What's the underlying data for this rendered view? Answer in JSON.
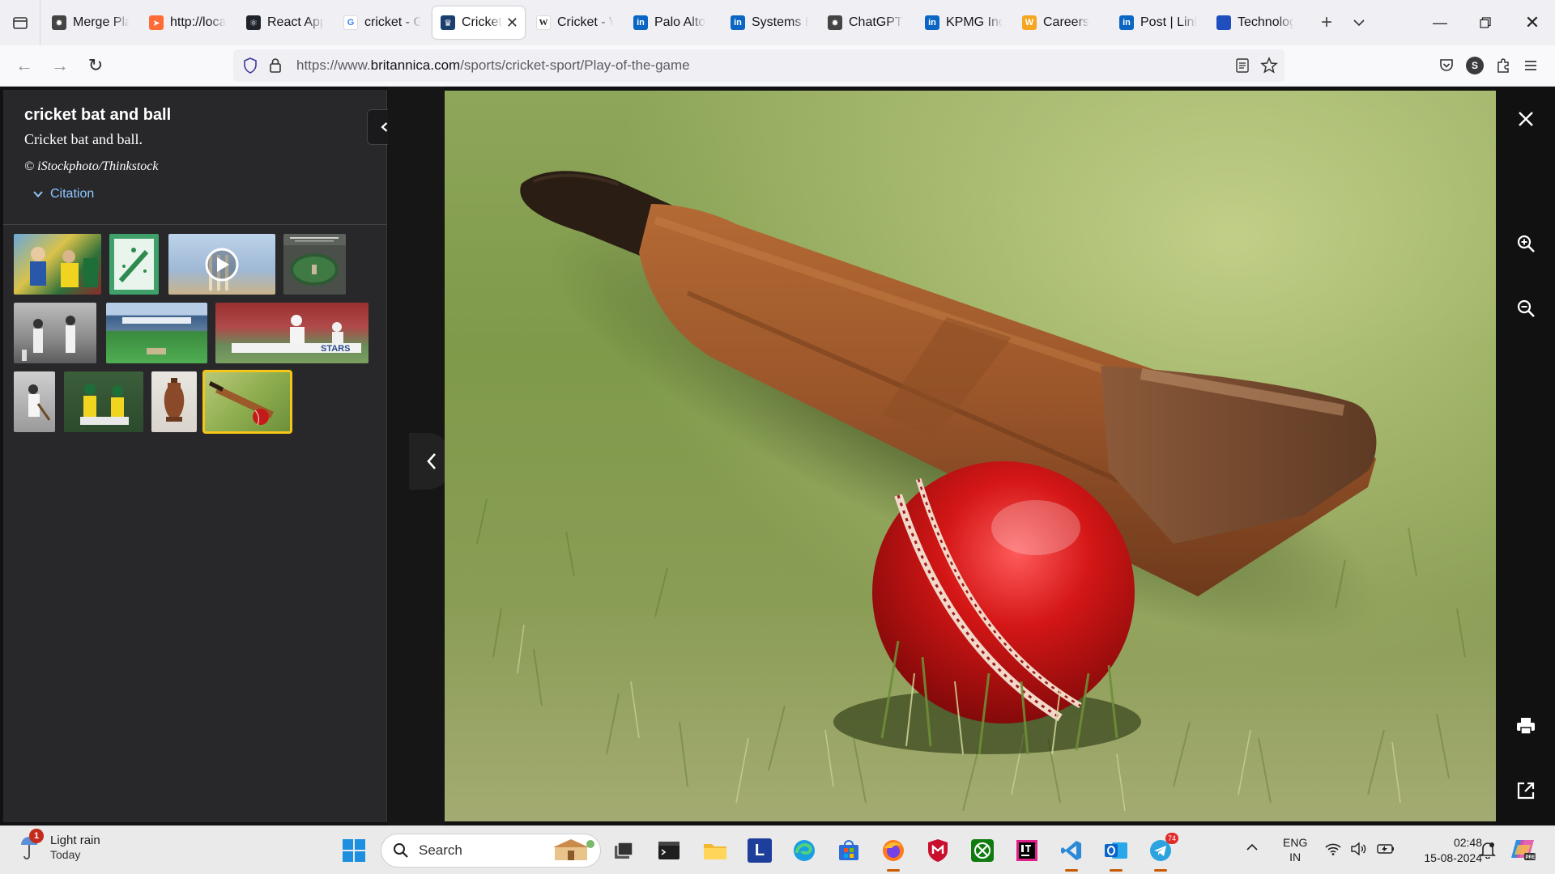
{
  "browser": {
    "tabs": [
      {
        "label": "Merge Pla",
        "icon": "chatgpt-icon",
        "active": false
      },
      {
        "label": "http://loca",
        "icon": "postman-icon",
        "active": false
      },
      {
        "label": "React App",
        "icon": "react-icon",
        "active": false
      },
      {
        "label": "cricket - G",
        "icon": "google-icon",
        "active": false
      },
      {
        "label": "Cricket",
        "icon": "britannica-icon",
        "active": true
      },
      {
        "label": "Cricket - V",
        "icon": "wikipedia-icon",
        "active": false
      },
      {
        "label": "Palo Alto",
        "icon": "linkedin-icon",
        "active": false
      },
      {
        "label": "Systems E",
        "icon": "linkedin-icon",
        "active": false
      },
      {
        "label": "ChatGPT",
        "icon": "chatgpt-icon",
        "active": false
      },
      {
        "label": "KPMG Ind",
        "icon": "linkedin-icon",
        "active": false
      },
      {
        "label": "Careers",
        "icon": "workday-icon",
        "active": false
      },
      {
        "label": "Post | Link",
        "icon": "linkedin-icon",
        "active": false
      },
      {
        "label": "Technolog",
        "icon": "bookmark-blue-icon",
        "active": false
      }
    ],
    "url_prefix": "https://www.",
    "url_domain": "britannica.com",
    "url_path": "/sports/cricket-sport/Play-of-the-game",
    "profile_initial": "S"
  },
  "media": {
    "title": "cricket bat and ball",
    "description": "Cricket bat and ball.",
    "credit": "© iStockphoto/Thinkstock",
    "citation_label": "Citation"
  },
  "thumbnails": [
    {
      "name": "cricket-match-players",
      "kind": "photo"
    },
    {
      "name": "cricket-field-diagram",
      "kind": "diagram"
    },
    {
      "name": "cricket-stumps-video",
      "kind": "video"
    },
    {
      "name": "lords-cricket-ground-map",
      "kind": "photo"
    },
    {
      "name": "historic-batsman",
      "kind": "photo"
    },
    {
      "name": "cricket-stadium",
      "kind": "photo"
    },
    {
      "name": "batsman-wicketkeeper",
      "kind": "photo"
    },
    {
      "name": "historic-cricketer",
      "kind": "photo"
    },
    {
      "name": "cricket-fielders",
      "kind": "photo"
    },
    {
      "name": "ashes-urn",
      "kind": "photo"
    },
    {
      "name": "cricket-bat-and-ball",
      "kind": "photo",
      "selected": true
    }
  ],
  "taskbar": {
    "weather_text": "Light rain",
    "weather_sub": "Today",
    "weather_badge": "1",
    "search_placeholder": "Search",
    "telegram_badge": "74",
    "lang_top": "ENG",
    "lang_bottom": "IN",
    "time": "02:48",
    "date": "15-08-2024"
  },
  "colors": {
    "accent_selected_thumb": "#f5c518",
    "citation_link": "#8cc8ff",
    "panel_bg": "#28282b"
  }
}
